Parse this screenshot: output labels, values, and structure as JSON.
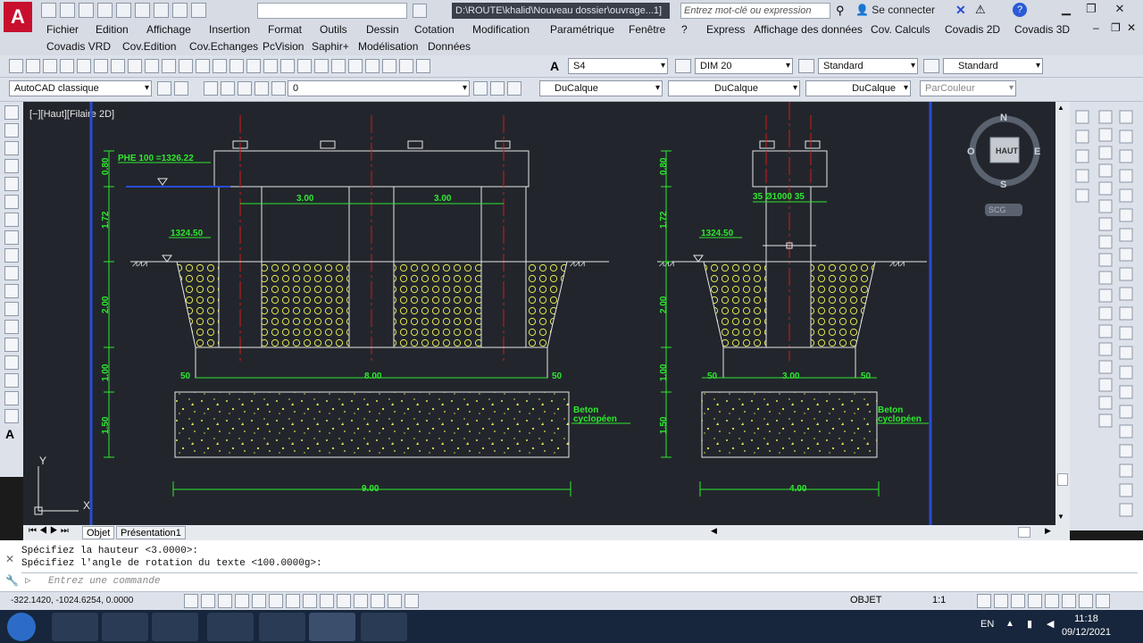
{
  "title_bar": {
    "path_text": "D:\\ROUTE\\khalid\\Nouveau dossier\\ouvrage...1]",
    "search_placeholder": "Entrez mot-clé ou expression",
    "connect_label": "Se connecter",
    "help_label": "?"
  },
  "menu": {
    "row1": [
      "Fichier",
      "Edition",
      "Affichage",
      "Insertion",
      "Format",
      "Outils",
      "Dessin",
      "Cotation",
      "Modification",
      "Paramétrique",
      "Fenêtre",
      "?",
      "Express",
      "Affichage des données",
      "Cov. Calculs",
      "Covadis 2D",
      "Covadis 3D"
    ],
    "row2": [
      "Covadis VRD",
      "Cov.Edition",
      "Cov.Echanges",
      "PcVision",
      "Saphir+",
      "Modélisation",
      "Données"
    ]
  },
  "toolbar1": {
    "text_style": "S4",
    "dim_style": "DIM 20",
    "table_style": "Standard",
    "multileader_style": "Standard"
  },
  "toolbar2": {
    "workspace": "AutoCAD classique",
    "layer": "0",
    "color": "DuCalque",
    "linetype": "DuCalque",
    "lineweight": "DuCalque",
    "plotstyle": "ParCouleur"
  },
  "viewport": {
    "label": "[−][Haut][Filaire 2D]",
    "compass": {
      "n": "N",
      "s": "S",
      "e": "E",
      "o": "O",
      "center": "HAUT",
      "wcs": "SCG"
    },
    "axis": {
      "y": "Y",
      "x": "X"
    }
  },
  "drawing": {
    "left": {
      "phe": "PHE 100 =1326.22",
      "level": "1324.50",
      "span1": "3.00",
      "span2": "3.00",
      "bottom_left": "50",
      "bottom_mid": "8.00",
      "bottom_right": "50",
      "overall": "9.00",
      "heights": [
        "0.80",
        "1.72",
        "2.00",
        "1.00",
        "1.50"
      ],
      "beton": [
        "Beton",
        "cyclopéen"
      ]
    },
    "right": {
      "pile": "35 Ø1000 35",
      "level": "1324.50",
      "bottom_left": "50",
      "bottom_mid": "3.00",
      "bottom_right": "50",
      "overall": "4.00",
      "heights": [
        "0.80",
        "1.72",
        "2.00",
        "1.00",
        "1.50"
      ],
      "beton": [
        "Beton",
        "cyclopéen"
      ]
    }
  },
  "tabs": [
    "Objet",
    "Présentation1"
  ],
  "command": {
    "line1": "Spécifiez la hauteur <3.0000>:",
    "line2": "Spécifiez l'angle de rotation du texte <100.0000g>:",
    "placeholder": "Entrez une commande"
  },
  "status": {
    "coords": "-322.1420, -1024.6254, 0.0000",
    "mode": "OBJET",
    "scale": "1:1"
  },
  "taskbar": {
    "lang": "EN",
    "time": "11:18",
    "date": "09/12/2021"
  },
  "colors": {
    "dim": "#2ee82e",
    "axis_red": "#d11a1a",
    "fill_yellow": "#e6e650",
    "canvas_bg": "#22262c",
    "blue_line": "#2a4bd6"
  }
}
